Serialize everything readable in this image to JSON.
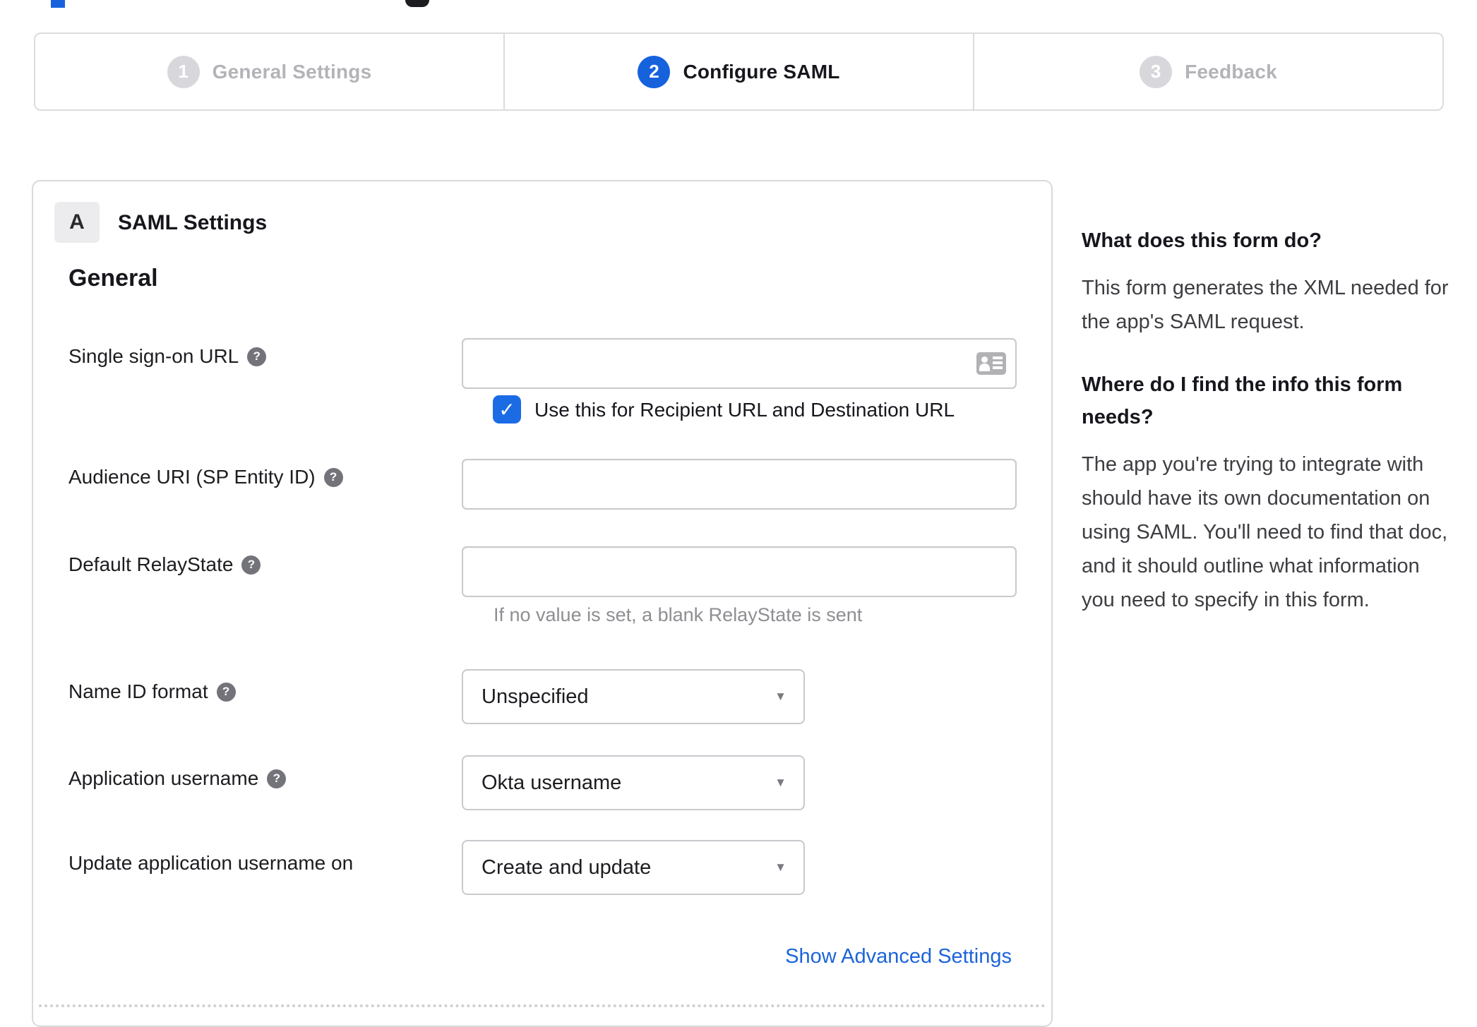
{
  "stepper": {
    "steps": [
      {
        "number": "1",
        "label": "General Settings",
        "state": "inactive"
      },
      {
        "number": "2",
        "label": "Configure SAML",
        "state": "active"
      },
      {
        "number": "3",
        "label": "Feedback",
        "state": "inactive"
      }
    ]
  },
  "panel": {
    "section_letter": "A",
    "section_title": "SAML Settings",
    "group_title": "General",
    "fields": {
      "sso_url": {
        "label": "Single sign-on URL",
        "value": ""
      },
      "sso_checkbox": {
        "label": "Use this for Recipient URL and Destination URL",
        "checked": true
      },
      "audience_uri": {
        "label": "Audience URI (SP Entity ID)",
        "value": ""
      },
      "relay_state": {
        "label": "Default RelayState",
        "value": "",
        "hint": "If no value is set, a blank RelayState is sent"
      },
      "name_id_format": {
        "label": "Name ID format",
        "value": "Unspecified"
      },
      "app_username": {
        "label": "Application username",
        "value": "Okta username"
      },
      "update_username": {
        "label": "Update application username on",
        "value": "Create and update"
      }
    },
    "advanced_link_label": "Show Advanced Settings"
  },
  "sidebar": {
    "q1": {
      "title": "What does this form do?",
      "body": "This form generates the XML needed for the app's SAML request."
    },
    "q2": {
      "title": "Where do I find the info this form needs?",
      "body": "The app you're trying to integrate with should have its own documentation on using SAML. You'll need to find that doc, and it should outline what information you need to specify in this form."
    }
  },
  "icons": {
    "help_glyph": "?",
    "caret_glyph": "▼",
    "check_glyph": "✓"
  },
  "colors": {
    "active_step_blue": "#1662dd",
    "checkbox_blue": "#1b6be5",
    "link_blue": "#1c64d9",
    "inactive_gray": "#d8d8dc",
    "border_gray": "#d9d9dd"
  }
}
